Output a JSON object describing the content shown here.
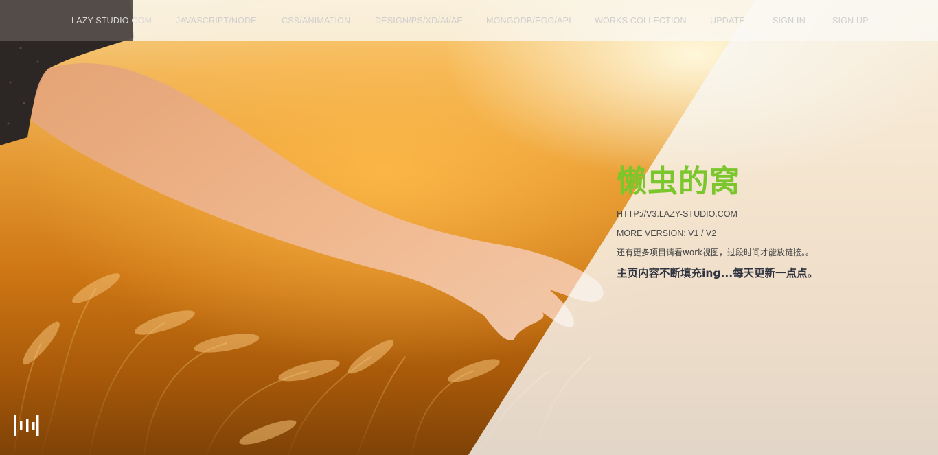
{
  "nav": {
    "items": [
      {
        "label": "LAZY-STUDIO.COM"
      },
      {
        "label": "JAVASCRIPT/NODE"
      },
      {
        "label": "CSS/ANIMATION"
      },
      {
        "label": "DESIGN/PS/XD/AI/AE"
      },
      {
        "label": "MONGODB/EGG/API"
      },
      {
        "label": "WORKS COLLECTION"
      },
      {
        "label": "UPDATE"
      },
      {
        "label": "SIGN IN"
      },
      {
        "label": "SIGN UP"
      }
    ]
  },
  "hero": {
    "title": "懒虫的窝",
    "url": "HTTP://V3.LAZY-STUDIO.COM",
    "version": "MORE VERSION: V1 / V2",
    "note": "还有更多项目请看work视图，过段时间才能放链接。。",
    "tagline": "主页内容不断填充ing...每天更新一点点。"
  },
  "logo": {
    "icon": "bars-logo-icon"
  },
  "colors": {
    "accent": "#7bc62d",
    "tagline": "#2f3340",
    "nav_text": "#cfcfcf"
  }
}
